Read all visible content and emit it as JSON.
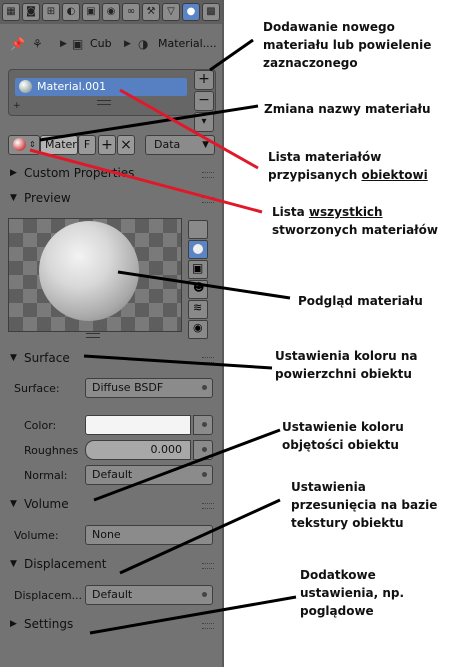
{
  "breadcrumb": {
    "object": "Cub",
    "material": "Material...."
  },
  "material_slots": {
    "items": [
      {
        "name": "Material.001"
      }
    ]
  },
  "datablock": {
    "name": "Mater",
    "fake_user": "F",
    "data_mode": "Data"
  },
  "sections": {
    "custom_properties": "Custom Properties",
    "preview": "Preview",
    "surface": "Surface",
    "volume": "Volume",
    "displacement": "Displacement",
    "settings": "Settings"
  },
  "surface": {
    "surface_label": "Surface:",
    "surface_value": "Diffuse BSDF",
    "color_label": "Color:",
    "roughness_label": "Roughnes",
    "roughness_value": "0.000",
    "normal_label": "Normal:",
    "normal_value": "Default"
  },
  "volume": {
    "label": "Volume:",
    "value": "None"
  },
  "displacement": {
    "label": "Displacem...",
    "value": "Default"
  },
  "annotations": {
    "add_material_1": "Dodawanie nowego",
    "add_material_2": "materiału lub powielenie",
    "add_material_3": "zaznaczonego",
    "rename": "Zmiana nazwy materiału",
    "object_list_1": "Lista materiałów",
    "object_list_2a": "przypisanych ",
    "object_list_2b": "obiektowi",
    "all_list_1a": "Lista ",
    "all_list_1b": "wszystkich",
    "all_list_2": "stworzonych materiałów",
    "preview": "Podgląd materiału",
    "surface_1": "Ustawienia koloru na",
    "surface_2": "powierzchni obiektu",
    "volume_1": "Ustawienie koloru",
    "volume_2": "objętości obiektu",
    "disp_1": "Ustawienia",
    "disp_2": "przesunięcia na bazie",
    "disp_3": "tekstury obiektu",
    "extra_1": "Dodatkowe",
    "extra_2": "ustawienia, np.",
    "extra_3": "poglądowe"
  },
  "colors": {
    "panel": "#737373",
    "selected": "#5680c2",
    "line_black": "#000000",
    "line_red": "#e0192a"
  },
  "icons": [
    "render-icon",
    "scene-icon",
    "world-icon",
    "object-icon",
    "constraints-icon",
    "modifiers-icon",
    "data-icon",
    "material-icon",
    "texture-icon",
    "pin-icon"
  ]
}
